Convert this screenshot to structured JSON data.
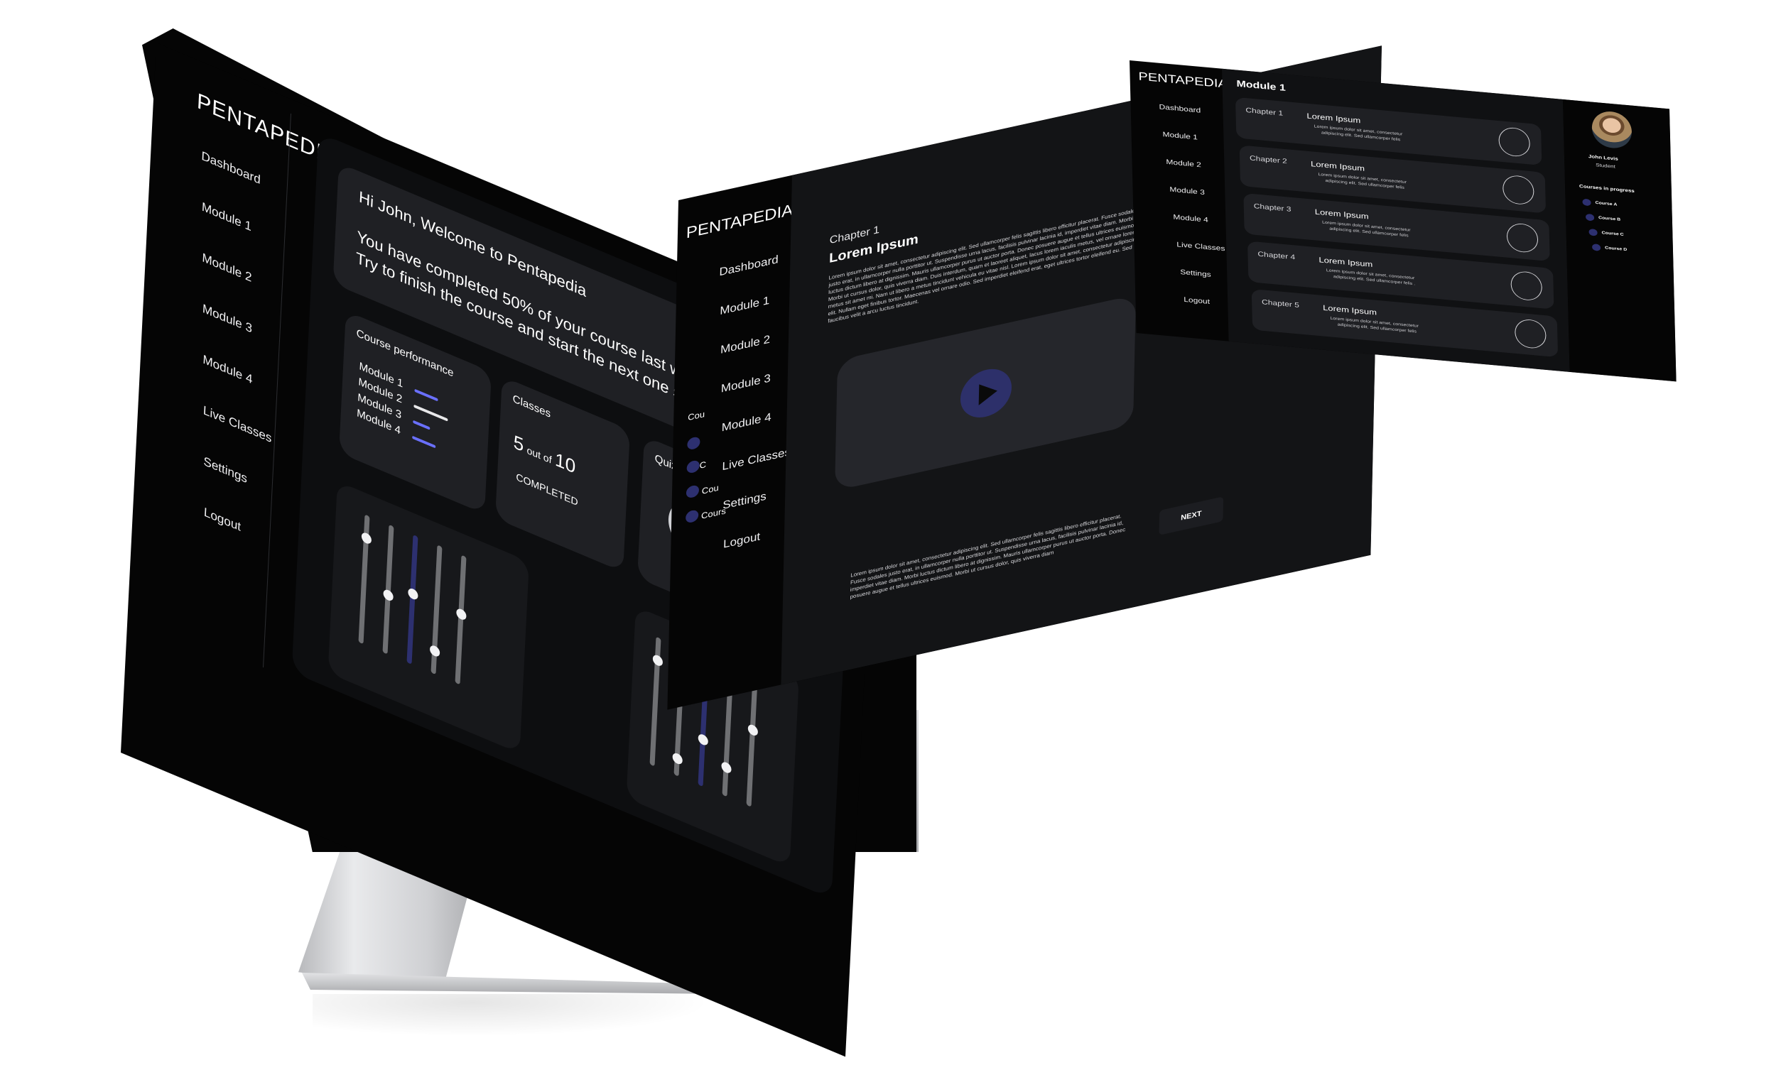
{
  "colors": {
    "bg": "#ffffff",
    "screen": "#050505",
    "card": "#1f2024",
    "accent": "#3d4189",
    "accent_light": "#6a70ff"
  },
  "brand": "PENTAPEDIA",
  "nav": [
    "Dashboard",
    "Module 1",
    "Module 2",
    "Module 3",
    "Module 4",
    "Live Classes",
    "Settings",
    "Logout"
  ],
  "dashboard": {
    "greeting": "Hi John, Welcome to Pentapedia",
    "message_line1": "You have completed 50% of your course last week.",
    "message_line2": "Try to finish the course and start the next one soon",
    "course_performance": {
      "title": "Course performance",
      "modules": [
        "Module 1",
        "Module 2",
        "Module 3",
        "Module 4"
      ],
      "values": [
        0.55,
        0.8,
        0.4,
        0.55
      ]
    },
    "classes": {
      "title": "Classes",
      "done": "5",
      "out_of": "out of",
      "total": "10",
      "status": "COMPLETED"
    },
    "quizzes": {
      "title": "Quizes",
      "completed_fraction": 0.25
    },
    "sliders_left": [
      0.85,
      0.45,
      0.55,
      0.15,
      0.55
    ],
    "sliders_right": [
      0.85,
      0.1,
      0.35,
      0.2,
      0.6
    ]
  },
  "lesson": {
    "chapter": "Chapter 1",
    "title": "Lorem Ipsum",
    "body_top": "Lorem ipsum dolor sit amet, consectetur adipiscing elit. Sed ullamcorper felis sagittis libero efficitur placerat. Fusce sodales justo erat, in ullamcorper nulla porttitor ut. Suspendisse urna lacus, facilisis pulvinar lacinia id, imperdiet vitae diam. Morbi luctus dictum libero at dignissim. Mauris ullamcorper purus ut auctor porta. Donec posuere augue et tellus ultrices euismod. Morbi ut cursus dolor, quis viverra diam. Duis interdum, quam et laoreet aliquet, lacus lorem iaculis metus, vel ornare lorem metus sit amet mi. Nam ut libero a metus tincidunt vehicula eu vitae nisl. Lorem ipsum dolor sit amet, consectetur adipiscing elit. Nullam eget finibus tortor. Maecenas vel ornare odio. Sed imperdiet eleifend erat, eget ultrices tortor eleifend eu. Sed faucibus velit a arcu luctus tincidunt.",
    "body_bottom": "Lorem ipsum dolor sit amet, consectetur adipiscing elit. Sed ullamcorper felis sagittis libero efficitur placerat. Fusce sodales justo erat, in ullamcorper nulla porttitor ut. Suspendisse urna lacus, facilisis pulvinar lacinia id, imperdiet vitae diam. Morbi luctus dictum libero at dignissim. Mauris ullamcorper purus ut auctor porta. Donec posuere augue et tellus ultrices euismod. Morbi ut cursus dolor, quis viverra diam",
    "next_button": "NEXT",
    "side_courses": [
      "Cou",
      "C",
      "Cou",
      "Cours"
    ]
  },
  "module_page": {
    "title": "Module 1",
    "chapters": [
      {
        "label": "Chapter 1",
        "name": "Lorem Ipsum",
        "desc1": "Lorem ipsum dolor sit amet, consectetur",
        "desc2": "adipiscing elit. Sed ullamcorper felis"
      },
      {
        "label": "Chapter 2",
        "name": "Lorem Ipsum",
        "desc1": "Lorem ipsum dolor sit amet, consectetur",
        "desc2": "adipiscing elit. Sed ullamcorper felis"
      },
      {
        "label": "Chapter 3",
        "name": "Lorem Ipsum",
        "desc1": "Lorem ipsum dolor sit amet, consectetur",
        "desc2": "adipiscing elit. Sed ullamcorper felis"
      },
      {
        "label": "Chapter 4",
        "name": "Lorem Ipsum",
        "desc1": "Lorem ipsum dolor sit amet, consectetur",
        "desc2": "adipiscing elit. Sed ullamcorper felis ."
      },
      {
        "label": "Chapter 5",
        "name": "Lorem Ipsum",
        "desc1": "Lorem ipsum dolor sit amet, consectetur",
        "desc2": "adipiscing elit. Sed ullamcorper felis"
      }
    ],
    "profile": {
      "name": "John Levis",
      "role": "Student"
    },
    "courses_title": "Courses in progress",
    "courses": [
      "Course A",
      "Course B",
      "Course C",
      "Course D"
    ]
  }
}
